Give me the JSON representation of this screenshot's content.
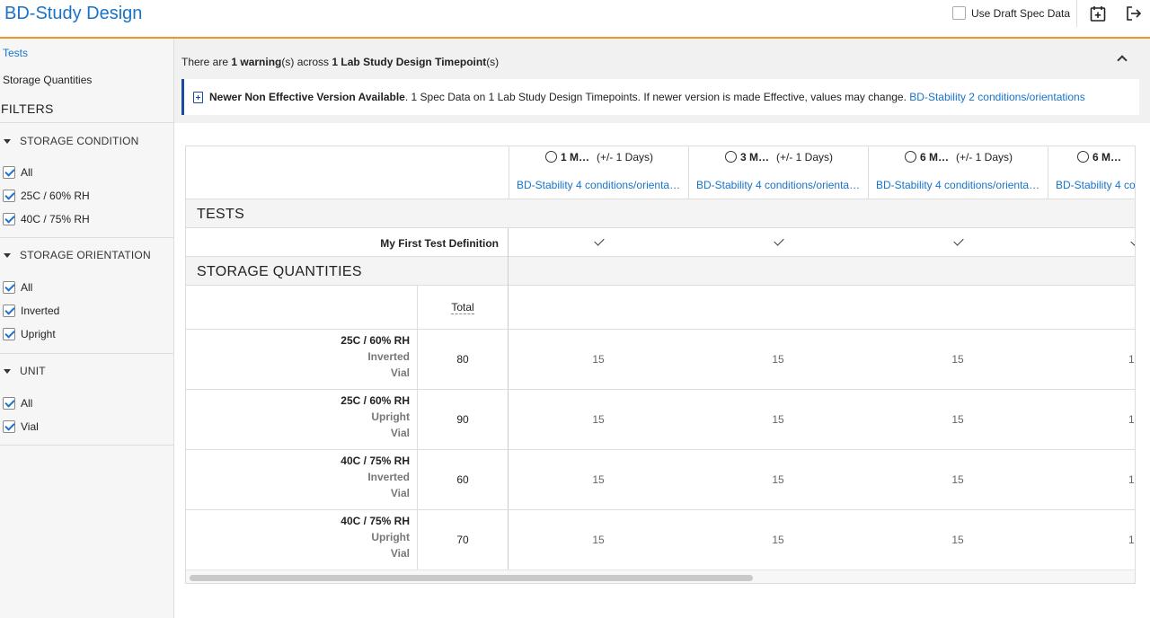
{
  "app": {
    "title": "BD-Study Design"
  },
  "header": {
    "draft_label": "Use Draft Spec Data",
    "icons": [
      "calendar-add-icon",
      "logout-icon"
    ]
  },
  "sidebar": {
    "links": [
      "Tests",
      "Storage Quantities"
    ],
    "filters_title": "FILTERS",
    "sections": [
      {
        "title": "STORAGE CONDITION",
        "items": [
          "All",
          "25C / 60% RH",
          "40C / 75% RH"
        ]
      },
      {
        "title": "STORAGE ORIENTATION",
        "items": [
          "All",
          "Inverted",
          "Upright"
        ]
      },
      {
        "title": "UNIT",
        "items": [
          "All",
          "Vial"
        ]
      }
    ]
  },
  "warning": {
    "summary_pre": "There are ",
    "summary_count": "1 warning",
    "summary_mid": "(s) across ",
    "summary_target": "1 Lab Study Design Timepoint",
    "summary_post": "(s)",
    "message_title": "Newer Non Effective Version Available",
    "message_body": ". 1 Spec Data on 1 Lab Study Design Timepoints. If newer version is made Effective, values may change. ",
    "message_link": "BD-Stability 2 conditions/orientations"
  },
  "timepoints": [
    {
      "name": "1 M…",
      "window": "(+/- 1 Days)",
      "link": "BD-Stability 4 conditions/orienta…"
    },
    {
      "name": "3 M…",
      "window": "(+/- 1 Days)",
      "link": "BD-Stability 4 conditions/orienta…"
    },
    {
      "name": "6 M…",
      "window": "(+/- 1 Days)",
      "link": "BD-Stability 4 conditions/orienta…"
    },
    {
      "name": "6 M…",
      "window": "",
      "link": "BD-Stability 4 co"
    }
  ],
  "tests": {
    "title": "TESTS",
    "rows": [
      {
        "name": "My First Test Definition",
        "checked": [
          true,
          true,
          true,
          true
        ]
      }
    ]
  },
  "storage": {
    "title": "STORAGE QUANTITIES",
    "total_header": "Total",
    "rows": [
      {
        "condition": "25C / 60% RH",
        "orientation": "Inverted",
        "unit": "Vial",
        "total": "80",
        "values": [
          "15",
          "15",
          "15",
          "1"
        ]
      },
      {
        "condition": "25C / 60% RH",
        "orientation": "Upright",
        "unit": "Vial",
        "total": "90",
        "values": [
          "15",
          "15",
          "15",
          "1"
        ]
      },
      {
        "condition": "40C / 75% RH",
        "orientation": "Inverted",
        "unit": "Vial",
        "total": "60",
        "values": [
          "15",
          "15",
          "15",
          "1"
        ]
      },
      {
        "condition": "40C / 75% RH",
        "orientation": "Upright",
        "unit": "Vial",
        "total": "70",
        "values": [
          "15",
          "15",
          "15",
          "1"
        ]
      }
    ]
  },
  "colors": {
    "accent": "#f0932b",
    "link": "#1a73c8",
    "warning_border": "#1a4aa0"
  }
}
